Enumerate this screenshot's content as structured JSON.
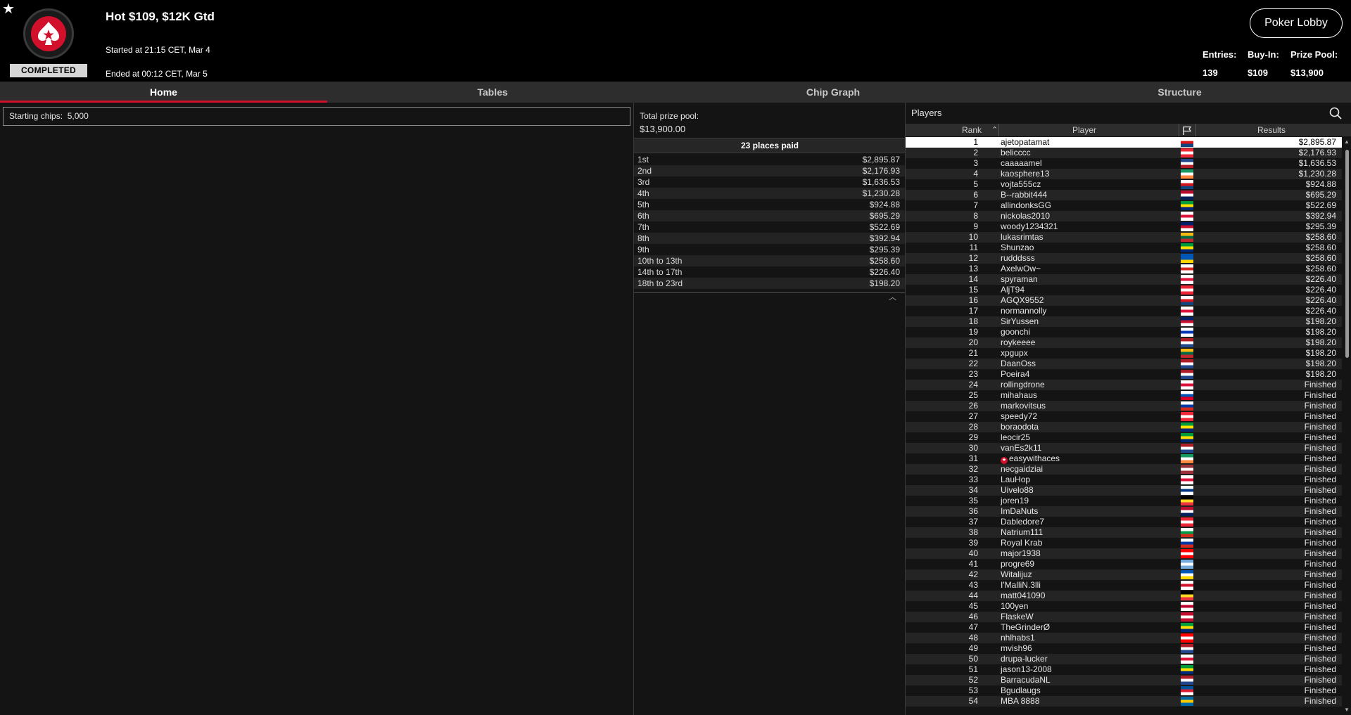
{
  "window": {
    "favorite_icon": "star-icon",
    "status": "COMPLETED",
    "title": "Hot $109, $12K Gtd",
    "started": "Started at 21:15 CET, Mar 4",
    "ended": "Ended at 00:12 CET, Mar 5",
    "lobby_button": "Poker Lobby",
    "stats": {
      "entries_label": "Entries:",
      "entries": "139",
      "buyin_label": "Buy-In:",
      "buyin": "$109",
      "prize_label": "Prize Pool:",
      "prize": "$13,900"
    },
    "brand_color": "#d2102b"
  },
  "tabs": [
    {
      "label": "Home",
      "active": true
    },
    {
      "label": "Tables",
      "active": false
    },
    {
      "label": "Chip Graph",
      "active": false
    },
    {
      "label": "Structure",
      "active": false
    }
  ],
  "home": {
    "starting_chips_label": "Starting chips:",
    "starting_chips": "5,000"
  },
  "prizes": {
    "pool_label": "Total prize pool:",
    "pool_value": "$13,900.00",
    "places_paid": "23 places paid",
    "payouts": [
      {
        "place": "1st",
        "amount": "$2,895.87"
      },
      {
        "place": "2nd",
        "amount": "$2,176.93"
      },
      {
        "place": "3rd",
        "amount": "$1,636.53"
      },
      {
        "place": "4th",
        "amount": "$1,230.28"
      },
      {
        "place": "5th",
        "amount": "$924.88"
      },
      {
        "place": "6th",
        "amount": "$695.29"
      },
      {
        "place": "7th",
        "amount": "$522.69"
      },
      {
        "place": "8th",
        "amount": "$392.94"
      },
      {
        "place": "9th",
        "amount": "$295.39"
      },
      {
        "place": "10th to 13th",
        "amount": "$258.60"
      },
      {
        "place": "14th to 17th",
        "amount": "$226.40"
      },
      {
        "place": "18th to 23rd",
        "amount": "$198.20"
      }
    ]
  },
  "players": {
    "title": "Players",
    "columns": {
      "rank": "Rank",
      "player": "Player",
      "results": "Results"
    },
    "rows": [
      {
        "rank": "1",
        "name": "ajetopatamat",
        "flag": [
          "#ffffff",
          "#d7141a",
          "#11457e"
        ],
        "result": "$2,895.87"
      },
      {
        "rank": "2",
        "name": "belicccc",
        "flag": [
          "#ed2939",
          "#ffffff",
          "#ed2939"
        ],
        "result": "$2,176.93"
      },
      {
        "rank": "3",
        "name": "caaaaamel",
        "flag": [
          "#21468b",
          "#ffffff",
          "#ae1c28"
        ],
        "result": "$1,636.53"
      },
      {
        "rank": "4",
        "name": "kaosphere13",
        "flag": [
          "#169b62",
          "#ffffff",
          "#ff883e"
        ],
        "result": "$1,230.28"
      },
      {
        "rank": "5",
        "name": "vojta555cz",
        "flag": [
          "#ffffff",
          "#d7141a",
          "#11457e"
        ],
        "result": "$924.88"
      },
      {
        "rank": "6",
        "name": "B--rabbit444",
        "flag": [
          "#ba0c2f",
          "#ffffff",
          "#00205b"
        ],
        "result": "$695.29"
      },
      {
        "rank": "7",
        "name": "allindonksGG",
        "flag": [
          "#009c3b",
          "#ffdf00",
          "#002776"
        ],
        "result": "$522.69"
      },
      {
        "rank": "8",
        "name": "nickolas2010",
        "flag": [
          "#ffffff",
          "#dc143c",
          "#ffffff"
        ],
        "result": "$392.94"
      },
      {
        "rank": "9",
        "name": "woody1234321",
        "flag": [
          "#012169",
          "#c8102e",
          "#ffffff"
        ],
        "result": "$295.39"
      },
      {
        "rank": "10",
        "name": "lukasrimtas",
        "flag": [
          "#fdb913",
          "#006a44",
          "#c1272d"
        ],
        "result": "$258.60"
      },
      {
        "rank": "11",
        "name": "Shunzao",
        "flag": [
          "#009c3b",
          "#ffdf00",
          "#002776"
        ],
        "result": "$258.60"
      },
      {
        "rank": "12",
        "name": "rudddsss",
        "flag": [
          "#0057b7",
          "#0057b7",
          "#ffd700"
        ],
        "result": "$258.60"
      },
      {
        "rank": "13",
        "name": "AxelwOw~",
        "flag": [
          "#ffffff",
          "#d52b1e",
          "#ffffff"
        ],
        "result": "$258.60"
      },
      {
        "rank": "14",
        "name": "spyraman",
        "flag": [
          "#ffffff",
          "#dc143c",
          "#ffffff"
        ],
        "result": "$226.40"
      },
      {
        "rank": "15",
        "name": "AljT94",
        "flag": [
          "#ed2939",
          "#ffffff",
          "#ed2939"
        ],
        "result": "$226.40"
      },
      {
        "rank": "16",
        "name": "AGQX9552",
        "flag": [
          "#ffffff",
          "#d7141a",
          "#11457e"
        ],
        "result": "$226.40"
      },
      {
        "rank": "17",
        "name": "normannolly",
        "flag": [
          "#ffffff",
          "#dc143c",
          "#ffffff"
        ],
        "result": "$226.40"
      },
      {
        "rank": "18",
        "name": "SirYussen",
        "flag": [
          "#012169",
          "#c8102e",
          "#ffffff"
        ],
        "result": "$198.20"
      },
      {
        "rank": "19",
        "name": "goonchi",
        "flag": [
          "#ffffff",
          "#0038b8",
          "#ffffff"
        ],
        "result": "$198.20"
      },
      {
        "rank": "20",
        "name": "roykeeee",
        "flag": [
          "#ae1c28",
          "#ffffff",
          "#21468b"
        ],
        "result": "$198.20"
      },
      {
        "rank": "21",
        "name": "xpgupx",
        "flag": [
          "#fdb913",
          "#006a44",
          "#c1272d"
        ],
        "result": "$198.20"
      },
      {
        "rank": "22",
        "name": "DaanOss",
        "flag": [
          "#ae1c28",
          "#ffffff",
          "#21468b"
        ],
        "result": "$198.20"
      },
      {
        "rank": "23",
        "name": "Poeira4",
        "flag": [
          "#ae1c28",
          "#ffffff",
          "#21468b"
        ],
        "result": "$198.20"
      },
      {
        "rank": "24",
        "name": "rollingdrone",
        "flag": [
          "#ffffff",
          "#dc143c",
          "#ffffff"
        ],
        "result": "Finished"
      },
      {
        "rank": "25",
        "name": "mihahaus",
        "flag": [
          "#ffffff",
          "#0052b4",
          "#d80027"
        ],
        "result": "Finished"
      },
      {
        "rank": "26",
        "name": "markovitsus",
        "flag": [
          "#ffffff",
          "#0039a6",
          "#d52b1e"
        ],
        "result": "Finished"
      },
      {
        "rank": "27",
        "name": "speedy72",
        "flag": [
          "#ed2939",
          "#ffffff",
          "#ed2939"
        ],
        "result": "Finished"
      },
      {
        "rank": "28",
        "name": "boraodota",
        "flag": [
          "#009c3b",
          "#ffdf00",
          "#002776"
        ],
        "result": "Finished"
      },
      {
        "rank": "29",
        "name": "leocir25",
        "flag": [
          "#009c3b",
          "#ffdf00",
          "#002776"
        ],
        "result": "Finished"
      },
      {
        "rank": "30",
        "name": "vanEs2k11",
        "flag": [
          "#ae1c28",
          "#ffffff",
          "#21468b"
        ],
        "result": "Finished"
      },
      {
        "rank": "31",
        "name": "easywithaces",
        "star": true,
        "flag": [
          "#169b62",
          "#ffffff",
          "#ff883e"
        ],
        "result": "Finished"
      },
      {
        "rank": "32",
        "name": "necgaidziai",
        "flag": [
          "#9e3039",
          "#ffffff",
          "#9e3039"
        ],
        "result": "Finished"
      },
      {
        "rank": "33",
        "name": "LauHop",
        "flag": [
          "#ffffff",
          "#dc143c",
          "#ffffff"
        ],
        "result": "Finished"
      },
      {
        "rank": "34",
        "name": "Uivelo88",
        "flag": [
          "#ffffff",
          "#003580",
          "#ffffff"
        ],
        "result": "Finished"
      },
      {
        "rank": "35",
        "name": "joren19",
        "flag": [
          "#000000",
          "#fdda24",
          "#ef3340"
        ],
        "result": "Finished"
      },
      {
        "rank": "36",
        "name": "ImDaNuts",
        "flag": [
          "#ba0c2f",
          "#ffffff",
          "#00205b"
        ],
        "result": "Finished"
      },
      {
        "rank": "37",
        "name": "Dabledore7",
        "flag": [
          "#ed2939",
          "#ffffff",
          "#ed2939"
        ],
        "result": "Finished"
      },
      {
        "rank": "38",
        "name": "Natrium111",
        "flag": [
          "#ffffff",
          "#009b48",
          "#d52b1e"
        ],
        "result": "Finished"
      },
      {
        "rank": "39",
        "name": "Royal Krab",
        "flag": [
          "#ffffff",
          "#0039a6",
          "#d52b1e"
        ],
        "result": "Finished"
      },
      {
        "rank": "40",
        "name": "major1938",
        "flag": [
          "#ff0000",
          "#ffffff",
          "#ff0000"
        ],
        "result": "Finished"
      },
      {
        "rank": "41",
        "name": "progre69",
        "flag": [
          "#74acdf",
          "#ffffff",
          "#74acdf"
        ],
        "result": "Finished"
      },
      {
        "rank": "42",
        "name": "Witalijuz",
        "flag": [
          "#0057b7",
          "#ffffff",
          "#ffd700"
        ],
        "result": "Finished"
      },
      {
        "rank": "43",
        "name": "I'MalliN.3lli",
        "flag": [
          "#ffffff",
          "#cf142b",
          "#ffffff"
        ],
        "result": "Finished"
      },
      {
        "rank": "44",
        "name": "matt041090",
        "flag": [
          "#000000",
          "#fdda24",
          "#ef3340"
        ],
        "result": "Finished"
      },
      {
        "rank": "45",
        "name": "100yen",
        "flag": [
          "#ffffff",
          "#bc002d",
          "#ffffff"
        ],
        "result": "Finished"
      },
      {
        "rank": "46",
        "name": "FlaskeW",
        "flag": [
          "#c60c30",
          "#ffffff",
          "#c60c30"
        ],
        "result": "Finished"
      },
      {
        "rank": "47",
        "name": "TheGrinderØ",
        "flag": [
          "#009c3b",
          "#ffdf00",
          "#002776"
        ],
        "result": "Finished"
      },
      {
        "rank": "48",
        "name": "nhlhabs1",
        "flag": [
          "#ff0000",
          "#ffffff",
          "#ff0000"
        ],
        "result": "Finished"
      },
      {
        "rank": "49",
        "name": "mvish96",
        "flag": [
          "#ae1c28",
          "#ffffff",
          "#21468b"
        ],
        "result": "Finished"
      },
      {
        "rank": "50",
        "name": "drupa-lucker",
        "flag": [
          "#ffffff",
          "#dc143c",
          "#ffffff"
        ],
        "result": "Finished"
      },
      {
        "rank": "51",
        "name": "jason13-2008",
        "flag": [
          "#009c3b",
          "#ffdf00",
          "#002776"
        ],
        "result": "Finished"
      },
      {
        "rank": "52",
        "name": "BarracudaNL",
        "flag": [
          "#ae1c28",
          "#ffffff",
          "#21468b"
        ],
        "result": "Finished"
      },
      {
        "rank": "53",
        "name": "Bgudlaugs",
        "flag": [
          "#02529c",
          "#dc1e35",
          "#ffffff"
        ],
        "result": "Finished"
      },
      {
        "rank": "54",
        "name": "MBA 8888",
        "flag": [
          "#006aa7",
          "#fecc00",
          "#006aa7"
        ],
        "result": "Finished"
      }
    ]
  }
}
